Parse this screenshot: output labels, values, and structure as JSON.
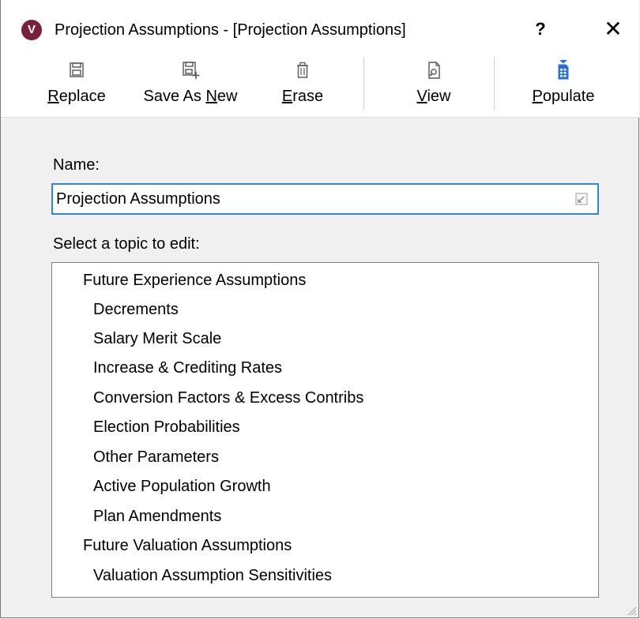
{
  "window": {
    "app_icon_letter": "V",
    "title": "Projection Assumptions - [Projection Assumptions]",
    "help_label": "?",
    "close_label": "✕"
  },
  "toolbar": {
    "replace": {
      "u": "R",
      "rest": "eplace"
    },
    "save_as_new": {
      "pre": "Save As ",
      "u": "N",
      "rest": "ew"
    },
    "erase": {
      "u": "E",
      "rest": "rase"
    },
    "view": {
      "u": "V",
      "rest": "iew"
    },
    "populate": {
      "u": "P",
      "rest": "opulate"
    }
  },
  "form": {
    "name_label": "Name:",
    "name_value": "Projection Assumptions",
    "topic_label": "Select a topic to edit:"
  },
  "topics": [
    {
      "label": "Future Experience Assumptions",
      "level": 0
    },
    {
      "label": "Decrements",
      "level": 1
    },
    {
      "label": "Salary Merit Scale",
      "level": 1
    },
    {
      "label": "Increase & Crediting Rates",
      "level": 1
    },
    {
      "label": "Conversion Factors & Excess Contribs",
      "level": 1
    },
    {
      "label": "Election Probabilities",
      "level": 1
    },
    {
      "label": "Other Parameters",
      "level": 1
    },
    {
      "label": "Active Population Growth",
      "level": 1
    },
    {
      "label": "Plan Amendments",
      "level": 1
    },
    {
      "label": "Future Valuation Assumptions",
      "level": 0
    },
    {
      "label": "Valuation Assumption Sensitivities",
      "level": 1
    }
  ],
  "colors": {
    "app_icon": "#7a1f3d",
    "focus_border": "#2f86d6",
    "populate_accent": "#2a6fd0"
  }
}
